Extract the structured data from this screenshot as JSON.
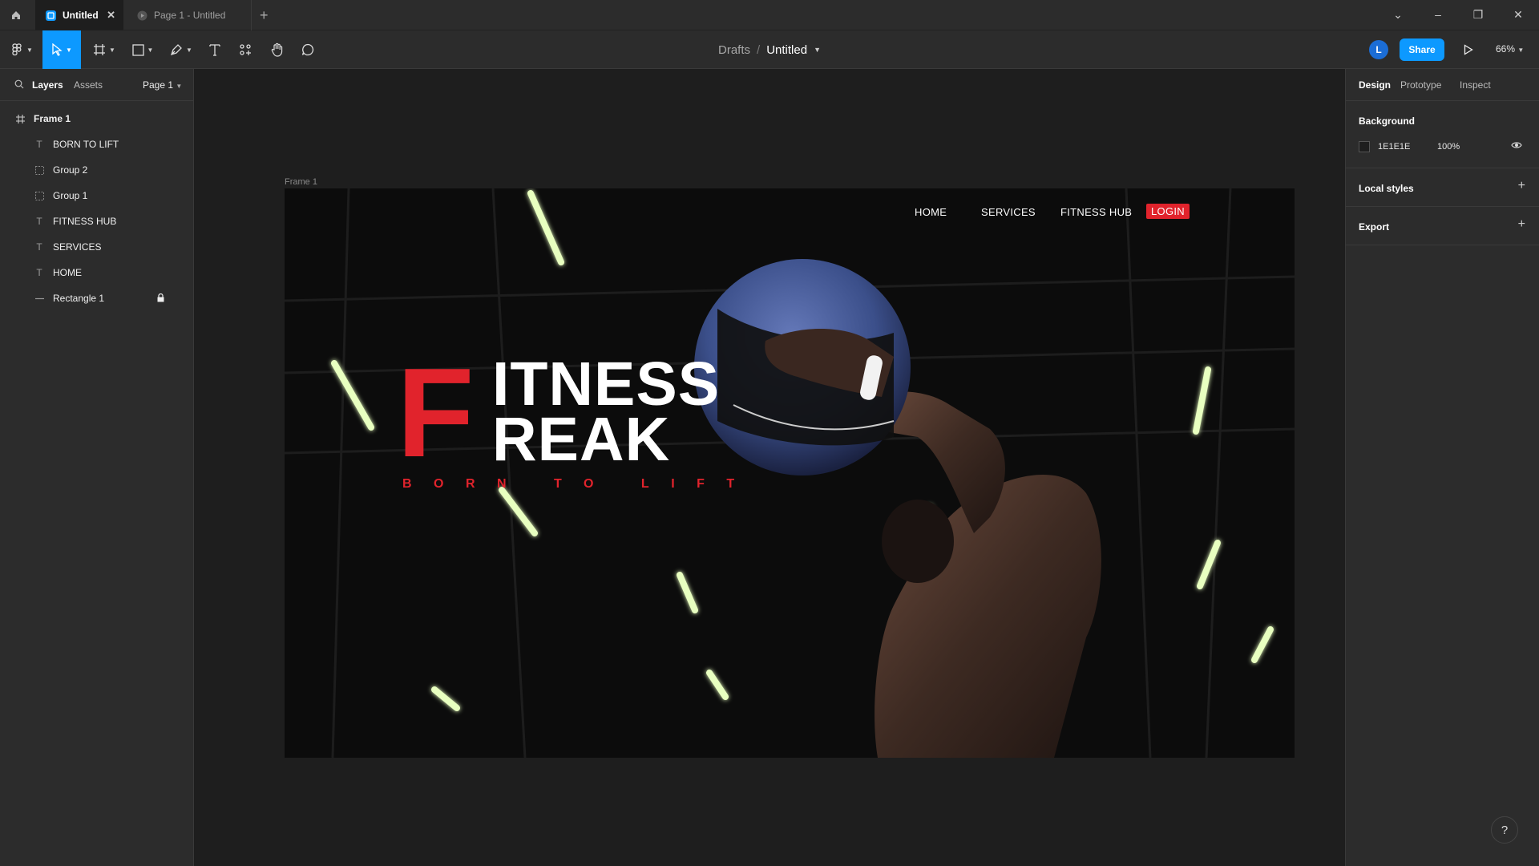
{
  "tabs": [
    {
      "label": "Untitled",
      "active": true
    },
    {
      "label": "Page 1 - Untitled",
      "active": false
    }
  ],
  "toolbar": {
    "breadcrumb_root": "Drafts",
    "breadcrumb_sep": "/",
    "file_name": "Untitled",
    "avatar_initial": "L",
    "share_label": "Share",
    "zoom": "66%"
  },
  "left_panel": {
    "tab_layers": "Layers",
    "tab_assets": "Assets",
    "page": "Page 1",
    "layers": [
      {
        "name": "Frame 1",
        "type": "frame"
      },
      {
        "name": "BORN TO LIFT",
        "type": "text"
      },
      {
        "name": "Group 2",
        "type": "group"
      },
      {
        "name": "Group 1",
        "type": "group"
      },
      {
        "name": "FITNESS HUB",
        "type": "text"
      },
      {
        "name": "SERVICES",
        "type": "text"
      },
      {
        "name": "HOME",
        "type": "text"
      },
      {
        "name": "Rectangle 1",
        "type": "rectangle",
        "locked": true
      }
    ]
  },
  "canvas": {
    "frame_label": "Frame 1",
    "nav": {
      "home": "HOME",
      "services": "SERVICES",
      "fitness_hub": "FITNESS HUB",
      "login": "LOGIN"
    },
    "hero": {
      "big_letter": "F",
      "line1": "ITNESS",
      "line2": "REAK",
      "tagline": "BORN TO LIFT"
    },
    "colors": {
      "accent": "#e1232c",
      "ball": "#3b4f8a",
      "light": "#e8ffc0"
    }
  },
  "right_panel": {
    "tab_design": "Design",
    "tab_prototype": "Prototype",
    "tab_inspect": "Inspect",
    "background_title": "Background",
    "background_hex": "1E1E1E",
    "background_opacity": "100%",
    "local_styles": "Local styles",
    "export": "Export"
  },
  "help": "?"
}
